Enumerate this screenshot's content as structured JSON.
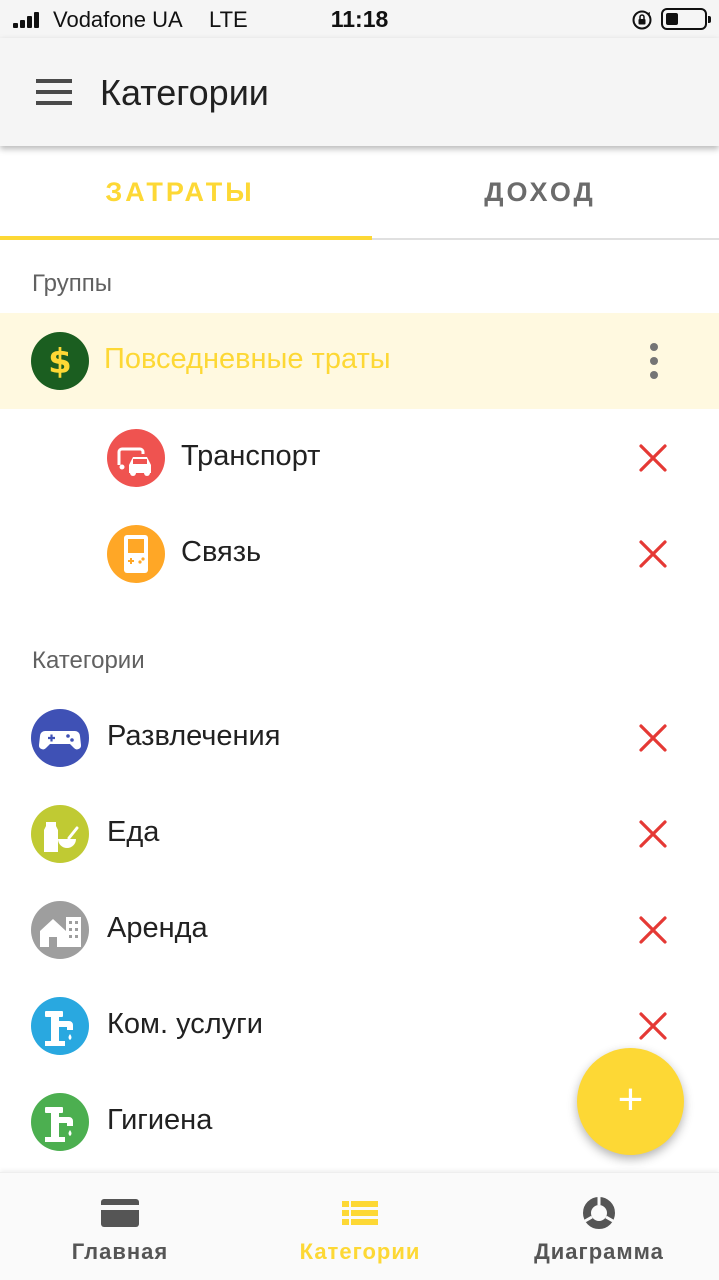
{
  "status_bar": {
    "carrier": "Vodafone UA",
    "network": "LTE",
    "time": "11:18"
  },
  "app_bar": {
    "title": "Категории",
    "menu_icon": "hamburger-menu-icon"
  },
  "tabs": [
    {
      "label": "ЗАТРАТЫ",
      "selected": true
    },
    {
      "label": "ДОХОД",
      "selected": false
    }
  ],
  "groups_section": {
    "header": "Группы",
    "group": {
      "label": "Повседневные траты",
      "icon": "dollar-icon",
      "color": "#1b5e20"
    },
    "children": [
      {
        "label": "Транспорт",
        "icon": "car-icon",
        "color": "#ef5350"
      },
      {
        "label": "Связь",
        "icon": "gameboy-icon",
        "color": "#ffa726"
      }
    ]
  },
  "categories_section": {
    "header": "Категории",
    "items": [
      {
        "label": "Развлечения",
        "icon": "gamepad-icon",
        "color": "#3f51b5"
      },
      {
        "label": "Еда",
        "icon": "food-icon",
        "color": "#c0ca33"
      },
      {
        "label": "Аренда",
        "icon": "building-icon",
        "color": "#9e9e9e"
      },
      {
        "label": "Ком. услуги",
        "icon": "faucet-icon",
        "color": "#29a8e0"
      },
      {
        "label": "Гигиена",
        "icon": "faucet-icon",
        "color": "#4caf50"
      }
    ]
  },
  "fab": {
    "label": "+",
    "icon": "plus-icon"
  },
  "bottom_nav": [
    {
      "label": "Главная",
      "icon": "card-icon",
      "active": false
    },
    {
      "label": "Категории",
      "icon": "list-icon",
      "active": true
    },
    {
      "label": "Диаграмма",
      "icon": "donut-chart-icon",
      "active": false
    }
  ],
  "colors": {
    "accent": "#fdd835",
    "delete": "#e53935",
    "group_background": "#fff9e0"
  }
}
